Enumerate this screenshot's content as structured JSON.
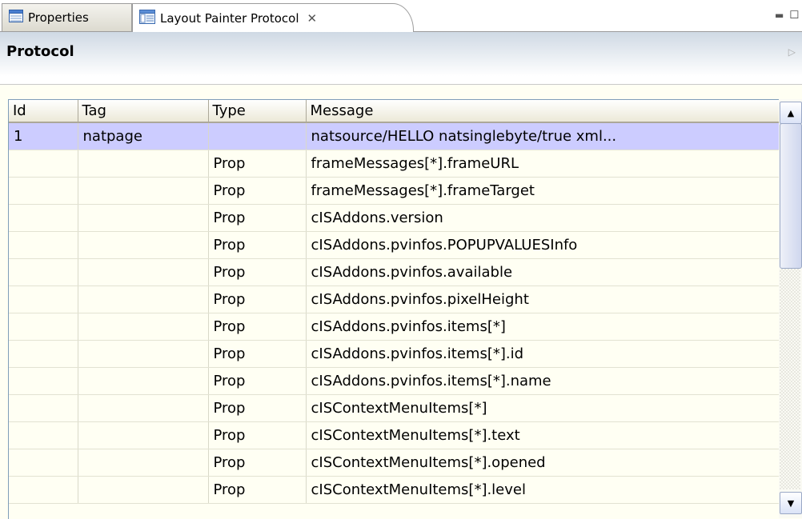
{
  "tabs": [
    {
      "label": "Properties",
      "icon": "properties-table-icon"
    },
    {
      "label": "Layout Painter Protocol",
      "icon": "layout-painter-icon",
      "active": true
    }
  ],
  "window_controls": {
    "minimize": "minimize-icon",
    "maximize": "maximize-icon"
  },
  "panel": {
    "title": "Protocol"
  },
  "table": {
    "columns": [
      "Id",
      "Tag",
      "Type",
      "Message"
    ],
    "rows": [
      {
        "id": "1",
        "tag": "natpage",
        "type": "",
        "message": "natsource/HELLO natsinglebyte/true xml...",
        "selected": true
      },
      {
        "id": "",
        "tag": "",
        "type": "Prop",
        "message": "frameMessages[*].frameURL"
      },
      {
        "id": "",
        "tag": "",
        "type": "Prop",
        "message": "frameMessages[*].frameTarget"
      },
      {
        "id": "",
        "tag": "",
        "type": "Prop",
        "message": "cISAddons.version"
      },
      {
        "id": "",
        "tag": "",
        "type": "Prop",
        "message": "cISAddons.pvinfos.POPUPVALUESInfo"
      },
      {
        "id": "",
        "tag": "",
        "type": "Prop",
        "message": "cISAddons.pvinfos.available"
      },
      {
        "id": "",
        "tag": "",
        "type": "Prop",
        "message": "cISAddons.pvinfos.pixelHeight"
      },
      {
        "id": "",
        "tag": "",
        "type": "Prop",
        "message": "cISAddons.pvinfos.items[*]"
      },
      {
        "id": "",
        "tag": "",
        "type": "Prop",
        "message": "cISAddons.pvinfos.items[*].id"
      },
      {
        "id": "",
        "tag": "",
        "type": "Prop",
        "message": "cISAddons.pvinfos.items[*].name"
      },
      {
        "id": "",
        "tag": "",
        "type": "Prop",
        "message": "cISContextMenuItems[*]"
      },
      {
        "id": "",
        "tag": "",
        "type": "Prop",
        "message": "cISContextMenuItems[*].text"
      },
      {
        "id": "",
        "tag": "",
        "type": "Prop",
        "message": "cISContextMenuItems[*].opened"
      },
      {
        "id": "",
        "tag": "",
        "type": "Prop",
        "message": "cISContextMenuItems[*].level"
      }
    ]
  },
  "colors": {
    "selected_row": "#ccccff",
    "row_background": "#fffff3",
    "header_gradient_top": "#cfd9e4"
  }
}
